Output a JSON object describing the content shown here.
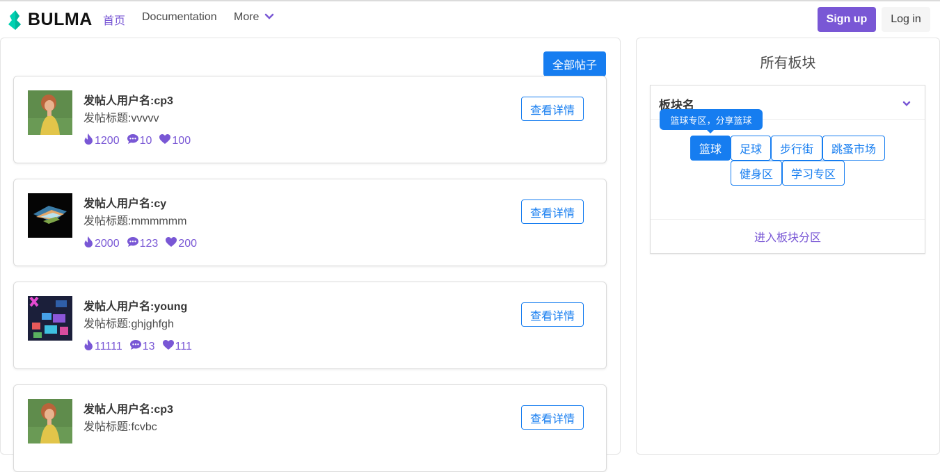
{
  "navbar": {
    "brand": "BULMA",
    "items": [
      "首页",
      "Documentation",
      "More"
    ],
    "signup": "Sign up",
    "login": "Log in",
    "accent": "#7957d5"
  },
  "posts_panel": {
    "all_posts_button": "全部帖子",
    "detail_button": "查看详情",
    "posts": [
      {
        "user": "发帖人用户名:cp3",
        "title": "发帖标题:vvvvv",
        "views": "1200",
        "comments": "10",
        "likes": "100",
        "avatar": "girl-painting"
      },
      {
        "user": "发帖人用户名:cy",
        "title": "发帖标题:mmmmmm",
        "views": "2000",
        "comments": "123",
        "likes": "200",
        "avatar": "abstract-dark"
      },
      {
        "user": "发帖人用户名:young",
        "title": "发帖标题:ghjghfgh",
        "views": "11111",
        "comments": "13",
        "likes": "111",
        "avatar": "neon-screens"
      },
      {
        "user": "发帖人用户名:cp3",
        "title": "发帖标题:fcvbc",
        "views": "",
        "comments": "",
        "likes": "",
        "avatar": "girl-painting"
      }
    ]
  },
  "boards_panel": {
    "heading": "所有板块",
    "card_title": "板块名",
    "tooltip": "篮球专区，分享篮球",
    "tags": [
      "篮球",
      "足球",
      "步行街",
      "跳蚤市场",
      "健身区",
      "学习专区"
    ],
    "enter_link": "进入板块分区"
  },
  "colors": {
    "primary": "#167df0",
    "purple": "#7957d5"
  }
}
